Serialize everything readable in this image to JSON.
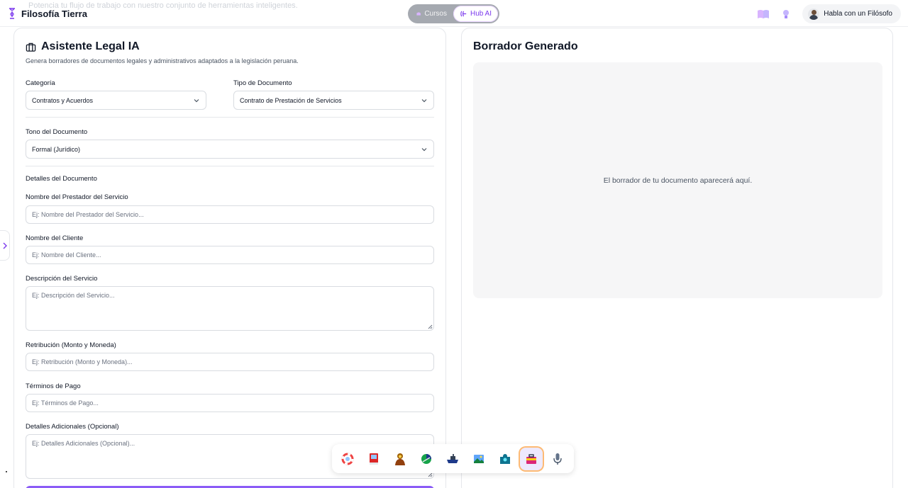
{
  "header": {
    "ghost_text": "Potencia tu flujo de trabajo con nuestro conjunto de herramientas inteligentes.",
    "brand": "Filosofía Tierra",
    "toggle": {
      "cursos": "Cursos",
      "hub": "Hub AI"
    },
    "philosopher_button": "Habla con un Filósofo"
  },
  "left_panel": {
    "title": "Asistente Legal IA",
    "subtitle": "Genera borradores de documentos legales y administrativos adaptados a la legislación peruana.",
    "category": {
      "label": "Categoría",
      "value": "Contratos y Acuerdos"
    },
    "doc_type": {
      "label": "Tipo de Documento",
      "value": "Contrato de Prestación de Servicios"
    },
    "tone": {
      "label": "Tono del Documento",
      "value": "Formal (Jurídico)"
    },
    "details_heading": "Detalles del Documento",
    "fields": {
      "provider": {
        "label": "Nombre del Prestador del Servicio",
        "placeholder": "Ej: Nombre del Prestador del Servicio..."
      },
      "client": {
        "label": "Nombre del Cliente",
        "placeholder": "Ej: Nombre del Cliente..."
      },
      "description": {
        "label": "Descripción del Servicio",
        "placeholder": "Ej: Descripción del Servicio..."
      },
      "retribution": {
        "label": "Retribución (Monto y Moneda)",
        "placeholder": "Ej: Retribución (Monto y Moneda)..."
      },
      "payment_terms": {
        "label": "Términos de Pago",
        "placeholder": "Ej: Términos de Pago..."
      },
      "additional": {
        "label": "Detalles Adicionales (Opcional)",
        "placeholder": "Ej: Detalles Adicionales (Opcional)..."
      }
    }
  },
  "right_panel": {
    "title": "Borrador Generado",
    "empty_text": "El borrador de tu documento aparecerá aquí."
  },
  "dock": {
    "items": [
      "lifebuoy-icon",
      "book-icon",
      "philosopher-icon",
      "globe-icon",
      "briefcase-icon",
      "image-icon",
      "puzzle-icon",
      "legal-toolbox-icon",
      "microphone-icon"
    ],
    "active_index": 7
  },
  "colors": {
    "accent": "#7c3aed",
    "generate_button": "#8b5cf6"
  }
}
